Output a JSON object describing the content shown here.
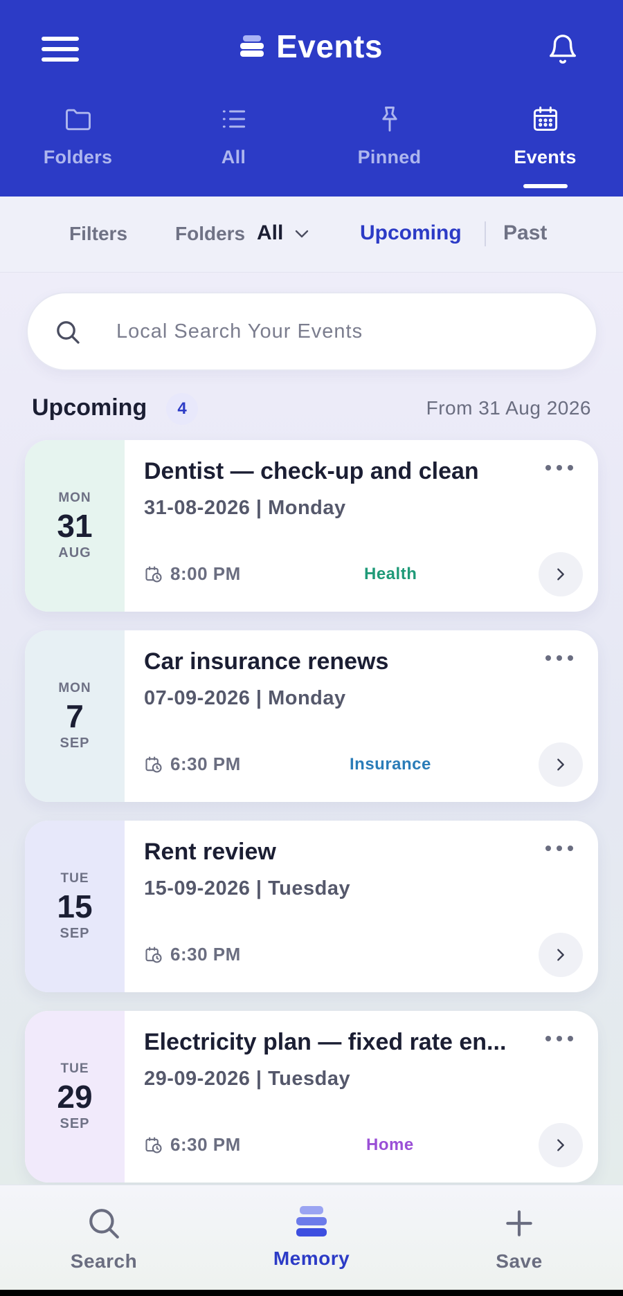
{
  "header": {
    "title": "Events",
    "tabs": [
      {
        "label": "Folders",
        "icon": "folder-icon",
        "active": false
      },
      {
        "label": "All",
        "icon": "list-icon",
        "active": false
      },
      {
        "label": "Pinned",
        "icon": "pin-icon",
        "active": false
      },
      {
        "label": "Events",
        "icon": "calendar-icon",
        "active": true
      }
    ]
  },
  "filterbar": {
    "filters_label": "Filters",
    "folders_label": "Folders",
    "folders_value": "All",
    "upcoming_label": "Upcoming",
    "past_label": "Past"
  },
  "search": {
    "placeholder": "Local Search Your Events",
    "value": ""
  },
  "section": {
    "title": "Upcoming",
    "count": "4",
    "from_date": "From 31 Aug 2026"
  },
  "events": [
    {
      "dow": "MON",
      "day": "31",
      "mon": "AUG",
      "title": "Dentist — check-up and clean",
      "date": "31-08-2026 | Monday",
      "time": "8:00 PM",
      "tag": "Health",
      "tag_color": "#1f9a78",
      "date_bg": "#e6f4ef"
    },
    {
      "dow": "MON",
      "day": "7",
      "mon": "SEP",
      "title": "Car insurance renews",
      "date": "07-09-2026 | Monday",
      "time": "6:30 PM",
      "tag": "Insurance",
      "tag_color": "#2a7cb8",
      "date_bg": "#e7f0f4"
    },
    {
      "dow": "TUE",
      "day": "15",
      "mon": "SEP",
      "title": "Rent review",
      "date": "15-09-2026 | Tuesday",
      "time": "6:30 PM",
      "tag": "",
      "tag_color": "",
      "date_bg": "#e7e8fa"
    },
    {
      "dow": "TUE",
      "day": "29",
      "mon": "SEP",
      "title": "Electricity plan — fixed rate en...",
      "date": "29-09-2026 | Tuesday",
      "time": "6:30 PM",
      "tag": "Home",
      "tag_color": "#9a4fd6",
      "date_bg": "#f1eafb"
    }
  ],
  "bottomnav": {
    "items": [
      {
        "label": "Search",
        "icon": "search-icon",
        "active": false
      },
      {
        "label": "Memory",
        "icon": "memory-stack-icon",
        "active": true
      },
      {
        "label": "Save",
        "icon": "plus-icon",
        "active": false
      }
    ]
  },
  "colors": {
    "brand": "#2c3bc6",
    "text_dark": "#1b1e33",
    "text_muted": "#6a6d80"
  }
}
